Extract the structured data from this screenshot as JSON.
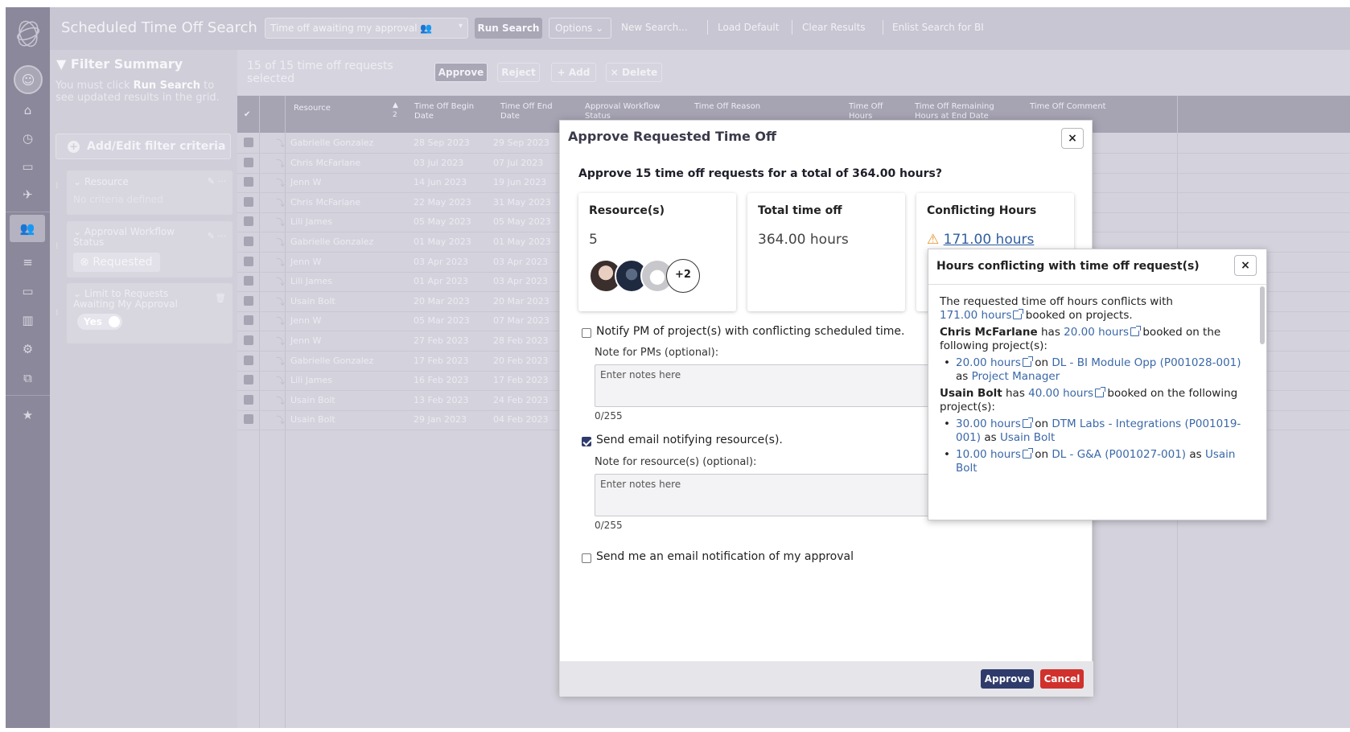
{
  "header": {
    "title": "Scheduled Time Off Search",
    "search_select": "Time off awaiting my approval",
    "run_search": "Run Search",
    "options": "Options",
    "links": [
      "New Search...",
      "Load Default",
      "Clear Results",
      "Enlist Search for BI"
    ]
  },
  "filter": {
    "title": "Filter Summary",
    "note_pre": "You must click ",
    "note_bold": "Run Search",
    "note_post": " to see updated results in the grid.",
    "add_button": "Add/Edit filter criteria",
    "cards": [
      {
        "title": "Resource",
        "value": "No criteria defined"
      },
      {
        "title": "Approval Workflow Status",
        "value": "Requested"
      },
      {
        "title": "Limit to Requests Awaiting My Approval",
        "value": "Yes"
      }
    ]
  },
  "results": {
    "count_text": "15 of 15 time off requests selected",
    "toolbar": {
      "approve": "Approve",
      "reject": "Reject",
      "add": "+ Add",
      "delete": "× Delete"
    },
    "columns": [
      "Resource",
      "Time Off Begin Date",
      "Time Off End Date",
      "Approval Workflow Status",
      "Time Off Reason",
      "Time Off Hours",
      "Time Off Remaining Hours at End Date",
      "Time Off Comment"
    ],
    "rows": [
      {
        "resource": "Gabrielle Gonzalez",
        "begin": "28 Sep 2023",
        "end": "29 Sep 2023"
      },
      {
        "resource": "Chris McFarlane",
        "begin": "03 Jul 2023",
        "end": "07 Jul 2023"
      },
      {
        "resource": "Jenn W",
        "begin": "14 Jun 2023",
        "end": "19 Jun 2023"
      },
      {
        "resource": "Chris McFarlane",
        "begin": "22 May 2023",
        "end": "31 May 2023"
      },
      {
        "resource": "Lili James",
        "begin": "05 May 2023",
        "end": "05 May 2023"
      },
      {
        "resource": "Gabrielle Gonzalez",
        "begin": "01 May 2023",
        "end": "01 May 2023"
      },
      {
        "resource": "Jenn W",
        "begin": "03 Apr 2023",
        "end": "03 Apr 2023"
      },
      {
        "resource": "Lili James",
        "begin": "01 Apr 2023",
        "end": "03 Apr 2023"
      },
      {
        "resource": "Usain Bolt",
        "begin": "20 Mar 2023",
        "end": "20 Mar 2023"
      },
      {
        "resource": "Jenn W",
        "begin": "05 Mar 2023",
        "end": "07 Mar 2023"
      },
      {
        "resource": "Jenn W",
        "begin": "27 Feb 2023",
        "end": "28 Feb 2023"
      },
      {
        "resource": "Gabrielle Gonzalez",
        "begin": "17 Feb 2023",
        "end": "20 Feb 2023"
      },
      {
        "resource": "Lili James",
        "begin": "16 Feb 2023",
        "end": "17 Feb 2023"
      },
      {
        "resource": "Usain Bolt",
        "begin": "13 Feb 2023",
        "end": "24 Feb 2023"
      },
      {
        "resource": "Usain Bolt",
        "begin": "29 Jan 2023",
        "end": "04 Feb 2023"
      }
    ]
  },
  "modal": {
    "title": "Approve Requested Time Off",
    "question": "Approve 15 time off requests for a total of 364.00 hours?",
    "resources_label": "Resource(s)",
    "resources_value": "5",
    "avatar_more": "+2",
    "total_label": "Total time off",
    "total_value": "364.00 hours",
    "conflict_label": "Conflicting Hours",
    "conflict_value": "171.00 hours",
    "notify_pm": "Notify PM of project(s) with conflicting scheduled time.",
    "note_pm_label": "Note for PMs (optional):",
    "notes_placeholder": "Enter notes here",
    "char_count": "0/255",
    "send_email": "Send email notifying resource(s).",
    "note_res_label": "Note for resource(s) (optional):",
    "send_me": "Send me an email notification of my approval",
    "approve": "Approve",
    "cancel": "Cancel",
    "accent": "#2f3b6b",
    "danger": "#d0312d"
  },
  "popover": {
    "title": "Hours conflicting with time off request(s)",
    "intro_pre": "The requested time off hours conflicts with",
    "intro_hours": "171.00  hours",
    "intro_post": "booked on projects.",
    "people": [
      {
        "name": "Chris McFarlane",
        "has": "has",
        "hours": "20.00 hours",
        "post": "booked on the following project(s):",
        "items": [
          {
            "hours": "20.00 hours",
            "on": "on",
            "project": "DL - BI Module Opp (P001028-001)",
            "as": "as",
            "role": "Project Manager"
          }
        ]
      },
      {
        "name": "Usain Bolt",
        "has": "has",
        "hours": "40.00 hours",
        "post": "booked on the following project(s):",
        "items": [
          {
            "hours": "30.00 hours",
            "on": "on",
            "project": "DTM Labs - Integrations (P001019-001)",
            "as": "as",
            "role": "Usain Bolt"
          },
          {
            "hours": "10.00 hours",
            "on": "on",
            "project": "DL - G&A (P001027-001)",
            "as": "as",
            "role": "Usain Bolt"
          }
        ]
      }
    ]
  }
}
